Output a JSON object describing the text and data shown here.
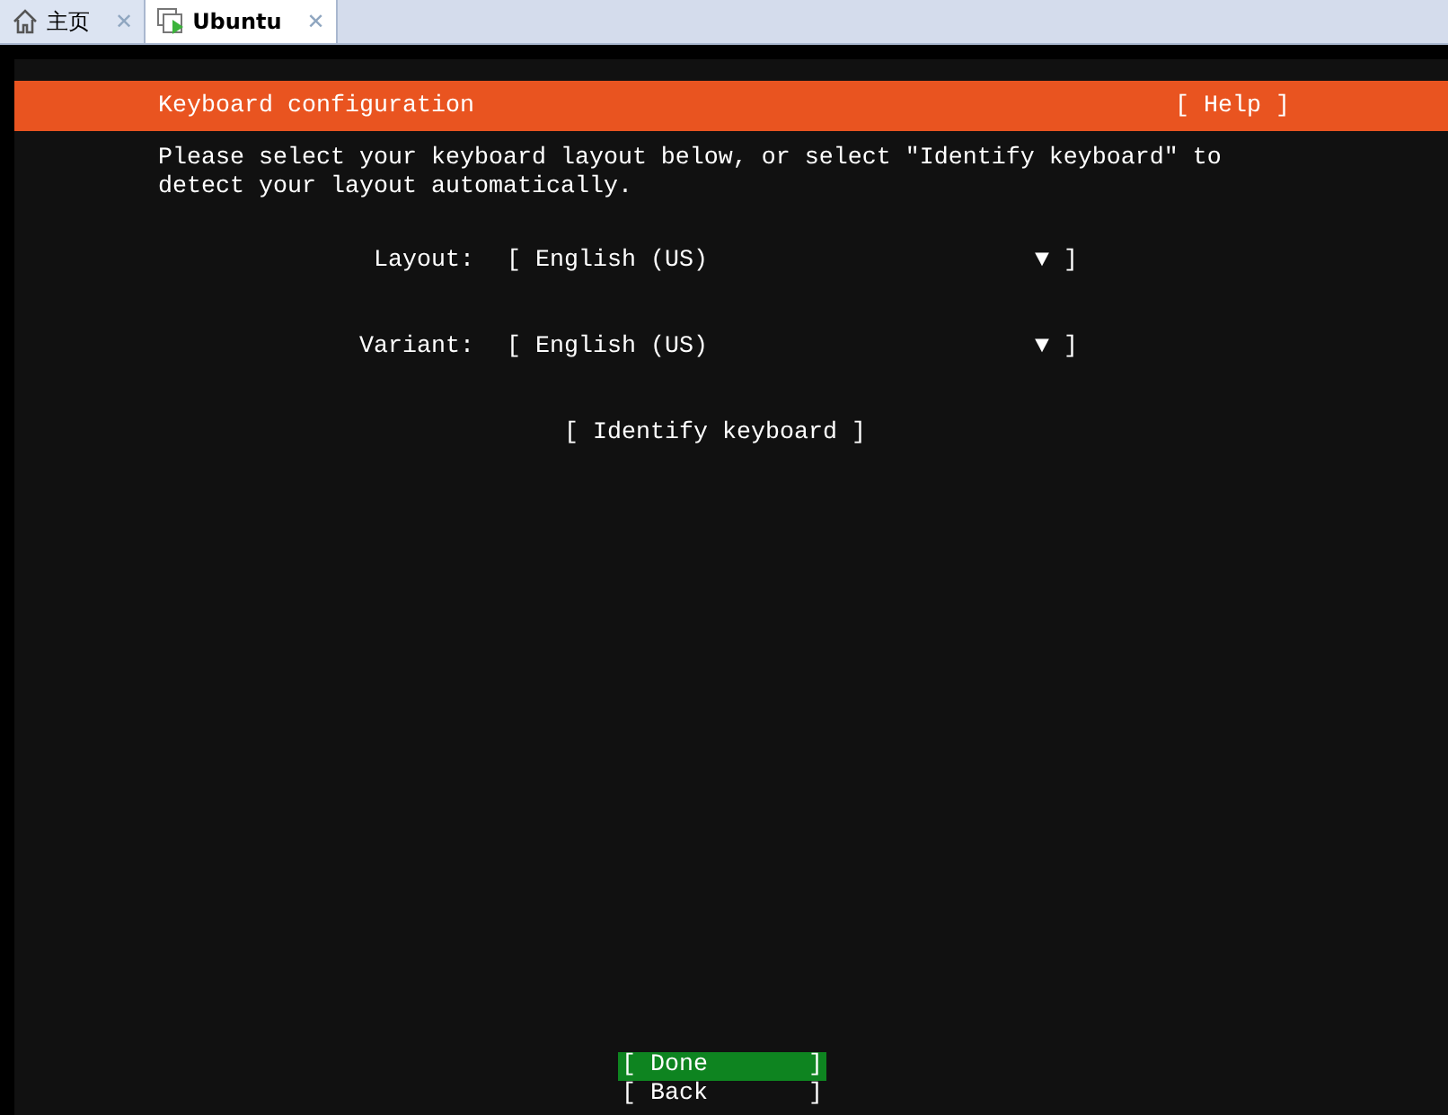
{
  "tabs": [
    {
      "label": "主页",
      "kind": "home",
      "close": "✕",
      "selected": false
    },
    {
      "label": "Ubuntu",
      "kind": "vm",
      "close": "✕",
      "selected": true
    }
  ],
  "header": {
    "title": "Keyboard configuration",
    "help": "[ Help ]"
  },
  "intro": "Please select your keyboard layout below, or select \"Identify keyboard\" to\ndetect your layout automatically.",
  "fields": [
    {
      "label": "Layout:",
      "open": "[",
      "value": "English (US)",
      "arrow": "▼",
      "close": "]"
    },
    {
      "label": "Variant:",
      "open": "[",
      "value": "English (US)",
      "arrow": "▼",
      "close": "]"
    }
  ],
  "identify": "[ Identify keyboard ]",
  "buttons": [
    {
      "label": "[ Done       ]",
      "selected": true
    },
    {
      "label": "[ Back       ]",
      "selected": false
    }
  ]
}
